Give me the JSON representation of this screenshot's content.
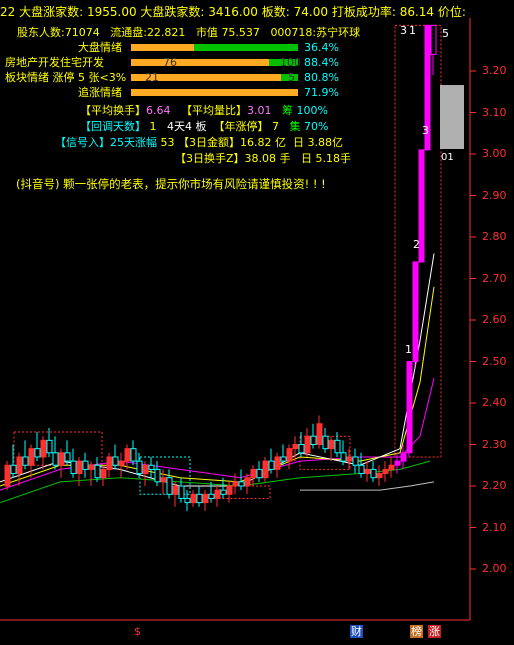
{
  "header": {
    "market_up_label": "22 大盘涨家数:",
    "market_up_value": "1955.00",
    "market_down_label": "大盘跌家数:",
    "market_down_value": "3416.00",
    "board_label": "板数:",
    "board_value": "74.00",
    "success_label": "打板成功率:",
    "success_value": "86.14",
    "price_label": "价位:"
  },
  "info": {
    "shareholders_label": "股东人数:",
    "shareholders_value": "71074",
    "float_label": "流通盘:",
    "float_value": "22.821",
    "mcap_label": "市值",
    "mcap_value": "75.537",
    "stock": "000718:苏宁环球"
  },
  "bars": [
    {
      "label": "大盘情绪",
      "pct": "36.4%",
      "fill_orange": 0.364,
      "fill_green": 0.636,
      "overlay": ""
    },
    {
      "label": "房地产开发住宅开发",
      "pct": "88.4%",
      "fill_orange": 0.72,
      "fill_green": 0.28,
      "overlay": "76",
      "overlay2": "100"
    },
    {
      "label": "板块情绪 涨停 5 张<3%",
      "pct": "80.8%",
      "fill_orange": 0.8,
      "fill_green": 0.2,
      "overlay": "21",
      "overlay2": "5"
    },
    {
      "label": "追涨情绪",
      "pct": "71.9%",
      "fill_orange": 0.719,
      "fill_green": 0.0,
      "overlay": ""
    }
  ],
  "stats": {
    "avg_turnover_label": "【平均换手】",
    "avg_turnover_value": "6.64",
    "avg_volratio_label": "【平均量比】",
    "avg_volratio_value": "3.01",
    "chip_label": "筹",
    "chip_value": "100%",
    "pullback_label": "【回调天数】",
    "pullback_value": "1",
    "days_board": "4天4 板",
    "year_limit_label": "【年涨停】",
    "year_limit_value": "7",
    "concentration_label": "集",
    "concentration_value": "70%",
    "signal_label": "【信号入】",
    "signal_value": "25天涨幅",
    "signal_num": "53",
    "amount_label": "【3日金额】",
    "amount_value": "16.82",
    "amount_unit": "亿",
    "day_label": "日",
    "day_amount": "3.88亿",
    "turnover3_label": "【3日换手Z】",
    "turnover3_value": "38.08",
    "turnover3_unit": "手",
    "day_turnover": "5.18手"
  },
  "notice": "(抖音号) 颗一张停的老表，提示你市场有风险请谨慎投资! ! !",
  "y_axis": [
    "3.20",
    "3.10",
    "3.00",
    "2.90",
    "2.80",
    "2.70",
    "2.60",
    "2.50",
    "2.40",
    "2.30",
    "2.20",
    "2.10",
    "2.00"
  ],
  "board_marks": [
    "1",
    "2",
    "3"
  ],
  "top_marks": [
    "3",
    "1",
    "5"
  ],
  "price_tag": "01",
  "bottom_labels": {
    "s": "$",
    "fin": "财",
    "bang": "榜",
    "zhang": "涨"
  },
  "colors": {
    "up": "#ff3030",
    "down": "#00ffff",
    "magenta": "#ff00ff",
    "green": "#00c000",
    "orange": "#ffaa22"
  }
}
